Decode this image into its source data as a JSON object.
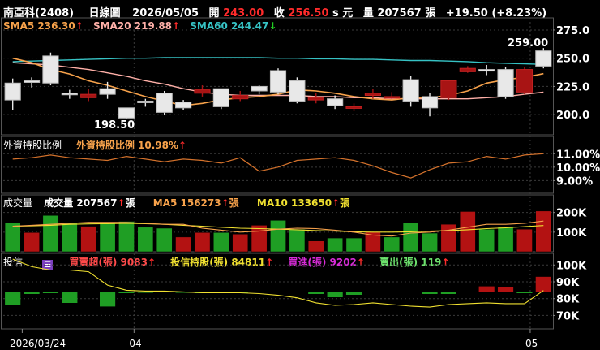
{
  "header": {
    "stock": "南亞科(2408)",
    "chart_type": "日線圖",
    "date": "2026/05/05",
    "open_label": "開",
    "open": "243.00",
    "close_label": "收",
    "close": "256.50",
    "close_flag": "s",
    "currency": "元",
    "volume_label": "量",
    "volume": "207567",
    "volume_unit": "張",
    "change": "+19.50 (+8.23%)"
  },
  "legend_price": {
    "sma5": "SMA5 236.30",
    "sma20": "SMA20 219.88",
    "sma60": "SMA60 244.47"
  },
  "legend_foreign": {
    "name": "外資持股比例",
    "value_label": "外資持股比例 10.98%"
  },
  "legend_volume": {
    "name": "成交量",
    "vol": "成交量 207567",
    "vol_unit": "張",
    "ma5": "MA5 156273",
    "ma5_unit": "張",
    "ma10": "MA10 133650",
    "ma10_unit": "張"
  },
  "legend_trust": {
    "name": "投信",
    "net": "買賣超(張) 9083",
    "hold": "投信持股(張) 84811",
    "buy": "買進(張) 9202",
    "sell": "賣出(張) 119"
  },
  "annotations": {
    "high": "259.00",
    "low": "198.50"
  },
  "x_labels": [
    "2026/03/24",
    "04",
    "05"
  ],
  "colors": {
    "up": "#e8e8e8",
    "down": "#a81414",
    "vol_up": "#b31212",
    "vol_down": "#1f9e24",
    "sma5": "#f7a24b",
    "sma20": "#ffb0a8",
    "sma60": "#36c2c4",
    "foreign": "#d4722c",
    "trust_line": "#f0e030",
    "grid": "#3a3a3a"
  },
  "chart_data": [
    {
      "type": "candlestick",
      "ylim": [
        185,
        280
      ],
      "yticks": [
        200,
        225,
        250,
        275
      ],
      "ytick_labels": [
        "200.0",
        "225.0",
        "250.0",
        "275.0"
      ],
      "candles": [
        {
          "o": 213,
          "h": 232,
          "l": 204,
          "c": 228
        },
        {
          "o": 229,
          "h": 233,
          "l": 224,
          "c": 230
        },
        {
          "o": 228,
          "h": 255,
          "l": 226,
          "c": 252
        },
        {
          "o": 219,
          "h": 222,
          "l": 214,
          "c": 219
        },
        {
          "o": 218,
          "h": 223,
          "l": 212,
          "c": 215
        },
        {
          "o": 218,
          "h": 229,
          "l": 214,
          "c": 223
        },
        {
          "o": 197,
          "h": 206,
          "l": 196,
          "c": 206
        },
        {
          "o": 211,
          "h": 214,
          "l": 207,
          "c": 212
        },
        {
          "o": 202,
          "h": 221,
          "l": 200,
          "c": 219
        },
        {
          "o": 206,
          "h": 213,
          "l": 204,
          "c": 211
        },
        {
          "o": 222,
          "h": 226,
          "l": 216,
          "c": 219
        },
        {
          "o": 207,
          "h": 223,
          "l": 205,
          "c": 223
        },
        {
          "o": 217,
          "h": 221,
          "l": 212,
          "c": 214
        },
        {
          "o": 221,
          "h": 226,
          "l": 218,
          "c": 225
        },
        {
          "o": 220,
          "h": 241,
          "l": 218,
          "c": 239
        },
        {
          "o": 212,
          "h": 233,
          "l": 210,
          "c": 230
        },
        {
          "o": 215,
          "h": 219,
          "l": 210,
          "c": 213
        },
        {
          "o": 208,
          "h": 217,
          "l": 205,
          "c": 214
        },
        {
          "o": 207,
          "h": 210,
          "l": 203,
          "c": 206
        },
        {
          "o": 219,
          "h": 223,
          "l": 214,
          "c": 217
        },
        {
          "o": 216,
          "h": 220,
          "l": 214,
          "c": 215
        },
        {
          "o": 212,
          "h": 234,
          "l": 207,
          "c": 231
        },
        {
          "o": 206,
          "h": 219,
          "l": 198.5,
          "c": 216
        },
        {
          "o": 230,
          "h": 231,
          "l": 213,
          "c": 215
        },
        {
          "o": 241,
          "h": 243,
          "l": 237,
          "c": 238
        },
        {
          "o": 240,
          "h": 244,
          "l": 235,
          "c": 240
        },
        {
          "o": 216,
          "h": 242,
          "l": 214,
          "c": 240
        },
        {
          "o": 240,
          "h": 242,
          "l": 218,
          "c": 220
        },
        {
          "o": 243,
          "h": 259,
          "l": 241,
          "c": 256.5
        }
      ],
      "sma5": [
        250,
        246,
        240,
        236,
        230,
        226,
        221,
        216,
        212,
        208,
        210,
        213,
        215,
        216,
        218,
        222,
        221,
        219,
        216,
        214,
        213,
        215,
        215,
        217,
        221,
        228,
        231,
        233,
        236.3
      ],
      "sma20": [
        246,
        245,
        244,
        242,
        240,
        237,
        234,
        230,
        227,
        223,
        220,
        218,
        217,
        217,
        217,
        217,
        216,
        216,
        215,
        215,
        214,
        214,
        214,
        214,
        214,
        215,
        216,
        218,
        219.9
      ],
      "sma60": [
        247,
        247.5,
        248,
        248.5,
        249,
        249.5,
        250,
        250,
        250.5,
        250.5,
        250.5,
        250.5,
        250.5,
        250.5,
        250,
        250,
        249.5,
        249.5,
        249,
        249,
        248.5,
        248,
        248,
        247.5,
        247,
        246,
        245.5,
        245,
        244.5
      ]
    },
    {
      "type": "line",
      "name": "外資持股比例",
      "ylim": [
        8.3,
        11.8
      ],
      "yticks": [
        9,
        10,
        11
      ],
      "ytick_labels": [
        "9.00%",
        "10.00%",
        "11.00%"
      ],
      "values": [
        10.6,
        10.7,
        10.9,
        10.7,
        10.6,
        10.5,
        10.8,
        10.6,
        10.4,
        10.6,
        10.5,
        10.3,
        10.7,
        9.7,
        10.0,
        10.5,
        10.6,
        10.7,
        10.5,
        10.1,
        9.6,
        9.2,
        9.8,
        10.3,
        10.4,
        10.8,
        10.6,
        10.9,
        11.0
      ]
    },
    {
      "type": "bar",
      "name": "成交量",
      "ylim": [
        0,
        240000
      ],
      "yticks": [
        100000,
        200000
      ],
      "ytick_labels": [
        "100K",
        "200K"
      ],
      "values": [
        150000,
        98000,
        185000,
        148000,
        130000,
        148000,
        155000,
        125000,
        120000,
        75000,
        98000,
        98000,
        90000,
        135000,
        160000,
        115000,
        55000,
        70000,
        70000,
        100000,
        75000,
        148000,
        95000,
        140000,
        205000,
        115000,
        125000,
        115000,
        207567
      ],
      "up": [
        false,
        true,
        false,
        false,
        true,
        false,
        false,
        false,
        false,
        true,
        true,
        false,
        true,
        true,
        false,
        false,
        true,
        false,
        false,
        true,
        false,
        false,
        false,
        true,
        true,
        false,
        false,
        true,
        true
      ],
      "ma5": [
        130000,
        135000,
        140000,
        145000,
        150000,
        150000,
        150000,
        145000,
        140000,
        140000,
        120000,
        110000,
        100000,
        105000,
        115000,
        120000,
        118000,
        110000,
        100000,
        85000,
        80000,
        95000,
        100000,
        110000,
        125000,
        140000,
        140000,
        145000,
        156273
      ],
      "ma10": [
        130000,
        132000,
        135000,
        140000,
        142000,
        143000,
        145000,
        143000,
        140000,
        135000,
        130000,
        125000,
        120000,
        118000,
        115000,
        112000,
        108000,
        105000,
        102000,
        100000,
        100000,
        102000,
        105000,
        108000,
        112000,
        118000,
        122000,
        128000,
        133650
      ]
    },
    {
      "type": "bar",
      "name": "投信",
      "ylim": [
        62000,
        104000
      ],
      "yticks": [
        70000,
        80000,
        90000,
        100000
      ],
      "ytick_labels": [
        "70K",
        "80K",
        "90K",
        "100K"
      ],
      "net": [
        -8500,
        -1500,
        -1000,
        -7000,
        0,
        -9200,
        -1000,
        -500,
        0,
        -500,
        -1000,
        -500,
        -500,
        0,
        0,
        0,
        -1500,
        -3500,
        -2000,
        0,
        0,
        0,
        -1500,
        -1500,
        0,
        3200,
        2500,
        -1000,
        9083
      ],
      "holdings": [
        103500,
        99000,
        97000,
        97000,
        96000,
        88000,
        85000,
        84500,
        84500,
        84000,
        83500,
        83500,
        83500,
        83000,
        82000,
        80500,
        77500,
        76000,
        76500,
        77500,
        76500,
        75500,
        75000,
        76500,
        77000,
        77500,
        77000,
        77000,
        84811
      ]
    }
  ]
}
